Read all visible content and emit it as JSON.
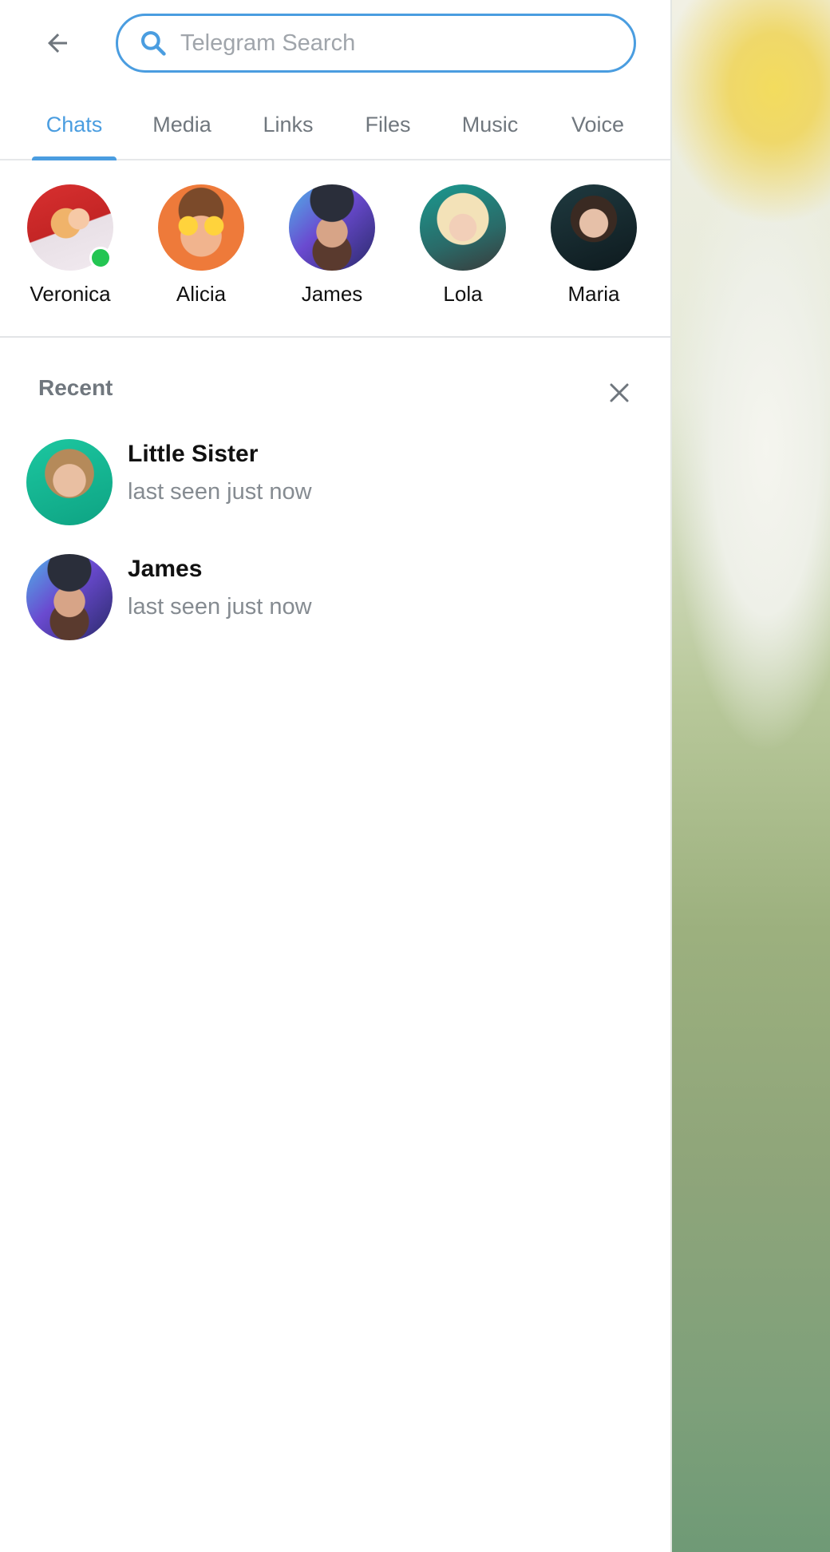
{
  "search": {
    "placeholder": "Telegram Search",
    "value": ""
  },
  "tabs": [
    {
      "label": "Chats",
      "active": true
    },
    {
      "label": "Media",
      "active": false
    },
    {
      "label": "Links",
      "active": false
    },
    {
      "label": "Files",
      "active": false
    },
    {
      "label": "Music",
      "active": false
    },
    {
      "label": "Voice",
      "active": false
    }
  ],
  "top_people": [
    {
      "name": "Veronica",
      "online": true
    },
    {
      "name": "Alicia",
      "online": false
    },
    {
      "name": "James",
      "online": false
    },
    {
      "name": "Lola",
      "online": false
    },
    {
      "name": "Maria",
      "online": false
    }
  ],
  "recent": {
    "title": "Recent",
    "items": [
      {
        "name": "Little Sister",
        "status": "last seen just now"
      },
      {
        "name": "James",
        "status": "last seen just now"
      }
    ]
  },
  "colors": {
    "accent": "#4a9de0",
    "online": "#23c552",
    "secondary_text": "#858b91"
  },
  "icons": {
    "back": "arrow-left-icon",
    "search": "search-icon",
    "clear_recent": "close-icon"
  }
}
